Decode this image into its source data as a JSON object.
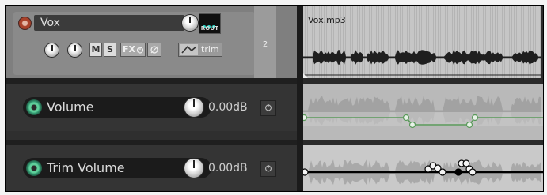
{
  "track": {
    "name": "Vox",
    "number": "2",
    "route_label": "ROUT",
    "mute_label": "M",
    "solo_label": "S",
    "fx_label": "FX",
    "trim_label": "trim",
    "icons": [
      "record-arm-icon",
      "volume-knob-icon",
      "pan-knob-icon",
      "fx-power-icon",
      "phase-invert-icon",
      "envelope-icon"
    ]
  },
  "envelopes": [
    {
      "name": "Volume",
      "value": "0.00dB"
    },
    {
      "name": "Trim Volume",
      "value": "0.00dB"
    }
  ],
  "item": {
    "name": "Vox.mp3"
  },
  "colors": {
    "volume_envelope": "#5a9a5a",
    "trim_envelope": "#000000",
    "record_arm": "#a8412a",
    "envelope_active": "#5fcf9a"
  }
}
